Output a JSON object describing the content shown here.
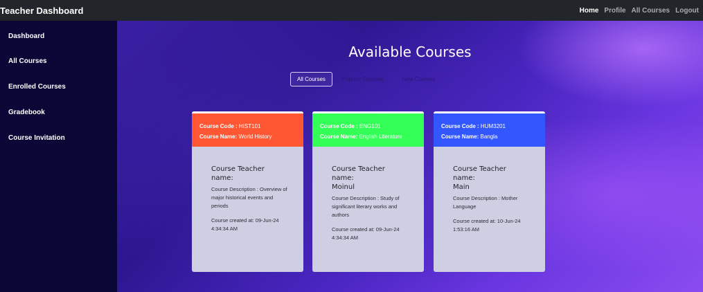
{
  "header": {
    "brand": "Teacher Dashboard",
    "nav": [
      "Home",
      "Profile",
      "All Courses",
      "Logout"
    ]
  },
  "sidebar": {
    "items": [
      "Dashboard",
      "All Courses",
      "Enrolled Courses",
      "Gradebook",
      "Course Invitation"
    ]
  },
  "main": {
    "title": "Available Courses",
    "tabs": [
      "All Courses",
      "Popular Courses",
      "New Courses"
    ],
    "cards": [
      {
        "code_label": "Course Code :",
        "code": "HIST101",
        "name_label": "Course Name:",
        "name": "World History",
        "color": "#ff5733",
        "teacher_label": "Course Teacher name:",
        "teacher": "",
        "description": "Course Description : Overview of major historical events and periods",
        "created": "Course created at: 09-Jun-24 4:34:34 AM"
      },
      {
        "code_label": "Course Code :",
        "code": "ENG101",
        "name_label": "Course Name:",
        "name": "English Literature",
        "color": "#33ff57",
        "teacher_label": "Course Teacher name:",
        "teacher": "Moinul",
        "description": "Course Description : Study of significant literary works and authors",
        "created": "Course created at: 09-Jun-24 4:34:34 AM"
      },
      {
        "code_label": "Course Code :",
        "code": "HUM3201",
        "name_label": "Course Name:",
        "name": "Bangla",
        "color": "#3357ff",
        "teacher_label": "Course Teacher name:",
        "teacher": "Main",
        "description": "Course Description : Mother Language",
        "created": "Course created at: 10-Jun-24 1:53:16 AM"
      }
    ]
  }
}
